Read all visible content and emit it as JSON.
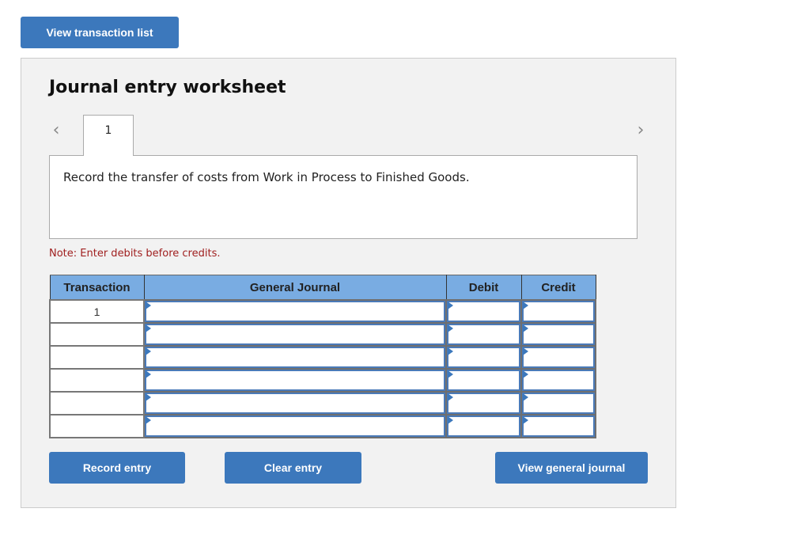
{
  "top": {
    "view_transaction_list_label": "View transaction list"
  },
  "worksheet": {
    "title": "Journal entry worksheet",
    "nav": {
      "prev_icon": "chevron-left-icon",
      "next_icon": "chevron-right-icon",
      "prev_glyph": "‹",
      "next_glyph": "›"
    },
    "tabs": [
      {
        "label": "1",
        "active": true
      }
    ],
    "description": "Record the transfer of costs from Work in Process to Finished Goods.",
    "note": "Note: Enter debits before credits.",
    "table": {
      "columns": [
        "Transaction",
        "General Journal",
        "Debit",
        "Credit"
      ],
      "rows": [
        {
          "transaction": "1",
          "account": "",
          "debit": "",
          "credit": ""
        },
        {
          "transaction": "",
          "account": "",
          "debit": "",
          "credit": ""
        },
        {
          "transaction": "",
          "account": "",
          "debit": "",
          "credit": ""
        },
        {
          "transaction": "",
          "account": "",
          "debit": "",
          "credit": ""
        },
        {
          "transaction": "",
          "account": "",
          "debit": "",
          "credit": ""
        },
        {
          "transaction": "",
          "account": "",
          "debit": "",
          "credit": ""
        }
      ]
    },
    "buttons": {
      "record": "Record entry",
      "clear": "Clear entry",
      "view_general_journal": "View general journal"
    }
  },
  "colors": {
    "button_bg": "#3c78bc",
    "header_bg": "#79ace2",
    "panel_bg": "#f2f2f2",
    "note_text": "#a02020"
  }
}
